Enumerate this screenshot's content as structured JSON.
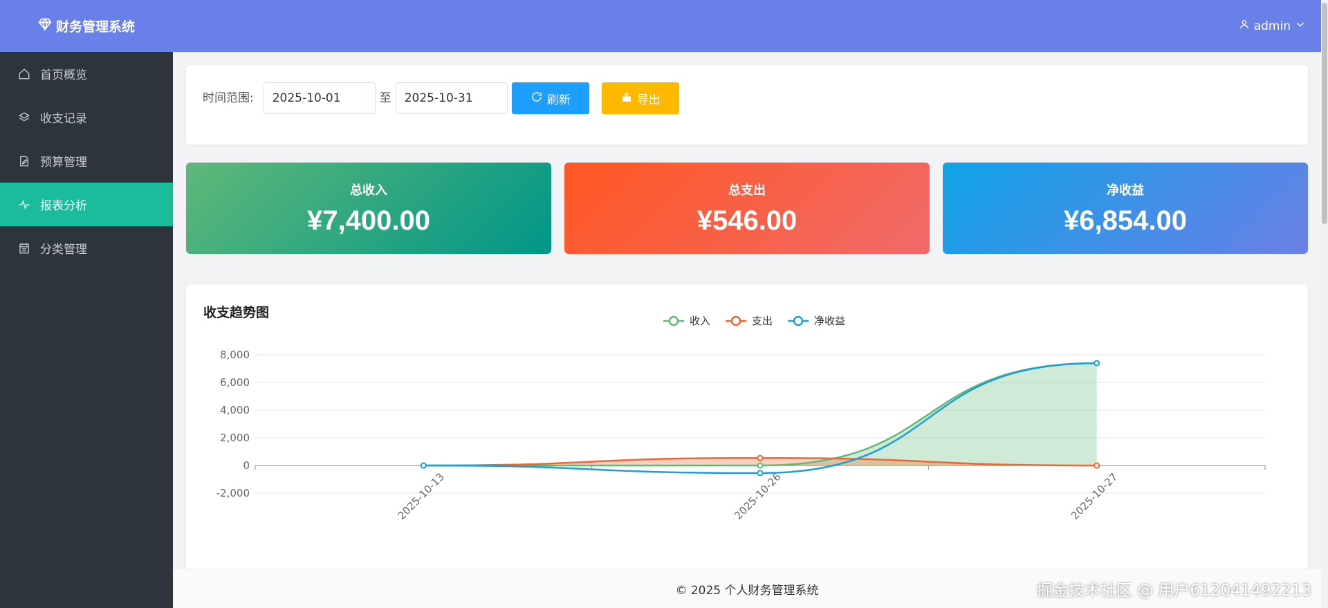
{
  "app": {
    "title": "财务管理系统",
    "brand_icon": "diamond-icon"
  },
  "header": {
    "username": "admin"
  },
  "sidebar": {
    "items": [
      {
        "label": "首页概览",
        "icon": "home-icon",
        "active": false
      },
      {
        "label": "收支记录",
        "icon": "layers-icon",
        "active": false
      },
      {
        "label": "预算管理",
        "icon": "edit-document-icon",
        "active": false
      },
      {
        "label": "报表分析",
        "icon": "pulse-icon",
        "active": true
      },
      {
        "label": "分类管理",
        "icon": "calendar-icon",
        "active": false
      }
    ]
  },
  "filter": {
    "label": "时间范围:",
    "start_date": "2025-10-01",
    "to_label": "至",
    "end_date": "2025-10-31",
    "refresh_label": "刷新",
    "export_label": "导出"
  },
  "stats": {
    "income": {
      "label": "总收入",
      "value": "¥7,400.00"
    },
    "expense": {
      "label": "总支出",
      "value": "¥546.00"
    },
    "net": {
      "label": "净收益",
      "value": "¥6,854.00"
    }
  },
  "chart": {
    "title": "收支趋势图"
  },
  "chart_data": {
    "type": "line",
    "title": "收支趋势图",
    "x": [
      "2025-10-13",
      "2025-10-26",
      "2025-10-27"
    ],
    "series": [
      {
        "name": "收入",
        "values": [
          0,
          0,
          7400
        ],
        "color": "#5fb878",
        "area": true
      },
      {
        "name": "支出",
        "values": [
          0,
          546,
          0
        ],
        "color": "#ee6633",
        "area": true
      },
      {
        "name": "净收益",
        "values": [
          0,
          -546,
          7400
        ],
        "color": "#1e9fd4",
        "area": false
      }
    ],
    "ylim": [
      -2000,
      8000
    ],
    "yticks": [
      -2000,
      0,
      2000,
      4000,
      6000,
      8000
    ],
    "ytick_labels": [
      "-2,000",
      "0",
      "2,000",
      "4,000",
      "6,000",
      "8,000"
    ],
    "legend": "top-center",
    "grid": true,
    "smooth": true
  },
  "footer": {
    "text": "© 2025 个人财务管理系统"
  },
  "watermark": {
    "text": "掘金技术社区 @ 用户612041492213"
  }
}
